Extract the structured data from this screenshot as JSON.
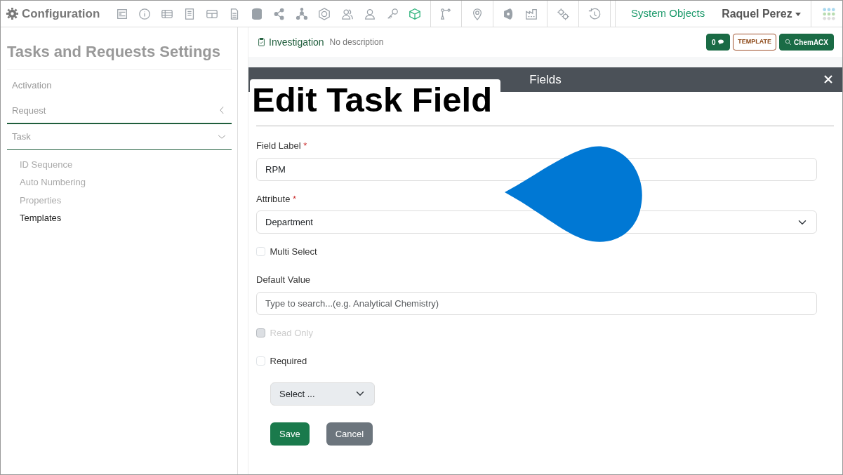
{
  "app": {
    "title": "Configuration"
  },
  "toolbar_icons": [
    {
      "selected": false
    },
    {
      "selected": false
    },
    {
      "selected": false
    },
    {
      "selected": false
    },
    {
      "selected": false
    },
    {
      "selected": false
    },
    {
      "selected": false
    },
    {
      "selected": false
    },
    {
      "selected": false
    },
    {
      "selected": false
    },
    {
      "selected": false
    },
    {
      "selected": false
    },
    {
      "selected": false
    },
    {
      "selected": true
    },
    {
      "selected": false
    },
    {
      "selected": false
    },
    {
      "selected": false
    },
    {
      "selected": false
    },
    {
      "selected": false
    },
    {
      "selected": false
    }
  ],
  "system_link": "System Objects",
  "user": "Raquel Perez",
  "sidebar": {
    "title": "Tasks and Requests Settings",
    "items": [
      {
        "label": "Activation",
        "kind": "link"
      },
      {
        "label": "Request",
        "kind": "group",
        "expanded": false
      },
      {
        "label": "Task",
        "kind": "group",
        "expanded": true,
        "children": [
          {
            "label": "ID Sequence",
            "selected": false
          },
          {
            "label": "Auto Numbering",
            "selected": false
          },
          {
            "label": "Properties",
            "selected": false
          },
          {
            "label": "Templates",
            "selected": true
          }
        ]
      }
    ]
  },
  "header": {
    "title": "Investigation",
    "description": "No description",
    "comment_count": "0",
    "template_badge": "TEMPLATE",
    "search_button": "ChemACX"
  },
  "dialog": {
    "bar_title": "Fields",
    "heading": "Edit Task Field",
    "fields": [
      {
        "kind": "text",
        "label": "Field Label",
        "required_mark": "*",
        "value": "RPM"
      },
      {
        "kind": "select",
        "label": "Attribute",
        "required_mark": "*",
        "value": "Department"
      },
      {
        "kind": "checkbox",
        "label": "Multi Select",
        "checked": false,
        "disabled": false
      },
      {
        "kind": "text",
        "label": "Default Value",
        "placeholder": "Type to search...(e.g. Analytical Chemistry)"
      },
      {
        "kind": "checkbox",
        "label": "Read Only",
        "checked": false,
        "disabled": true
      },
      {
        "kind": "checkbox",
        "label": "Required",
        "checked": false,
        "disabled": false
      },
      {
        "kind": "small-select",
        "value": "Select ..."
      }
    ],
    "buttons": [
      {
        "label": "Save",
        "kind": "primary"
      },
      {
        "label": "Cancel",
        "kind": "secondary"
      }
    ]
  }
}
